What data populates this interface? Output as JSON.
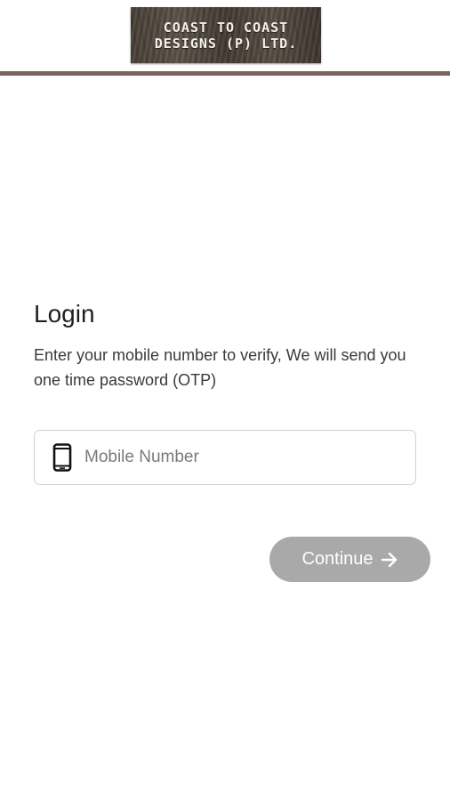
{
  "header": {
    "logo_line1": "COAST TO COAST",
    "logo_line2": "DESIGNS (P) LTD.",
    "rule_color": "#7a6660"
  },
  "login": {
    "title": "Login",
    "description": "Enter your mobile number to verify, We will send you one time password (OTP)",
    "mobile_field": {
      "icon": "smartphone-icon",
      "placeholder": "Mobile Number",
      "value": ""
    },
    "continue_button": {
      "label": "Continue",
      "icon": "arrow-right-icon",
      "color": "#a9a9a9"
    }
  }
}
